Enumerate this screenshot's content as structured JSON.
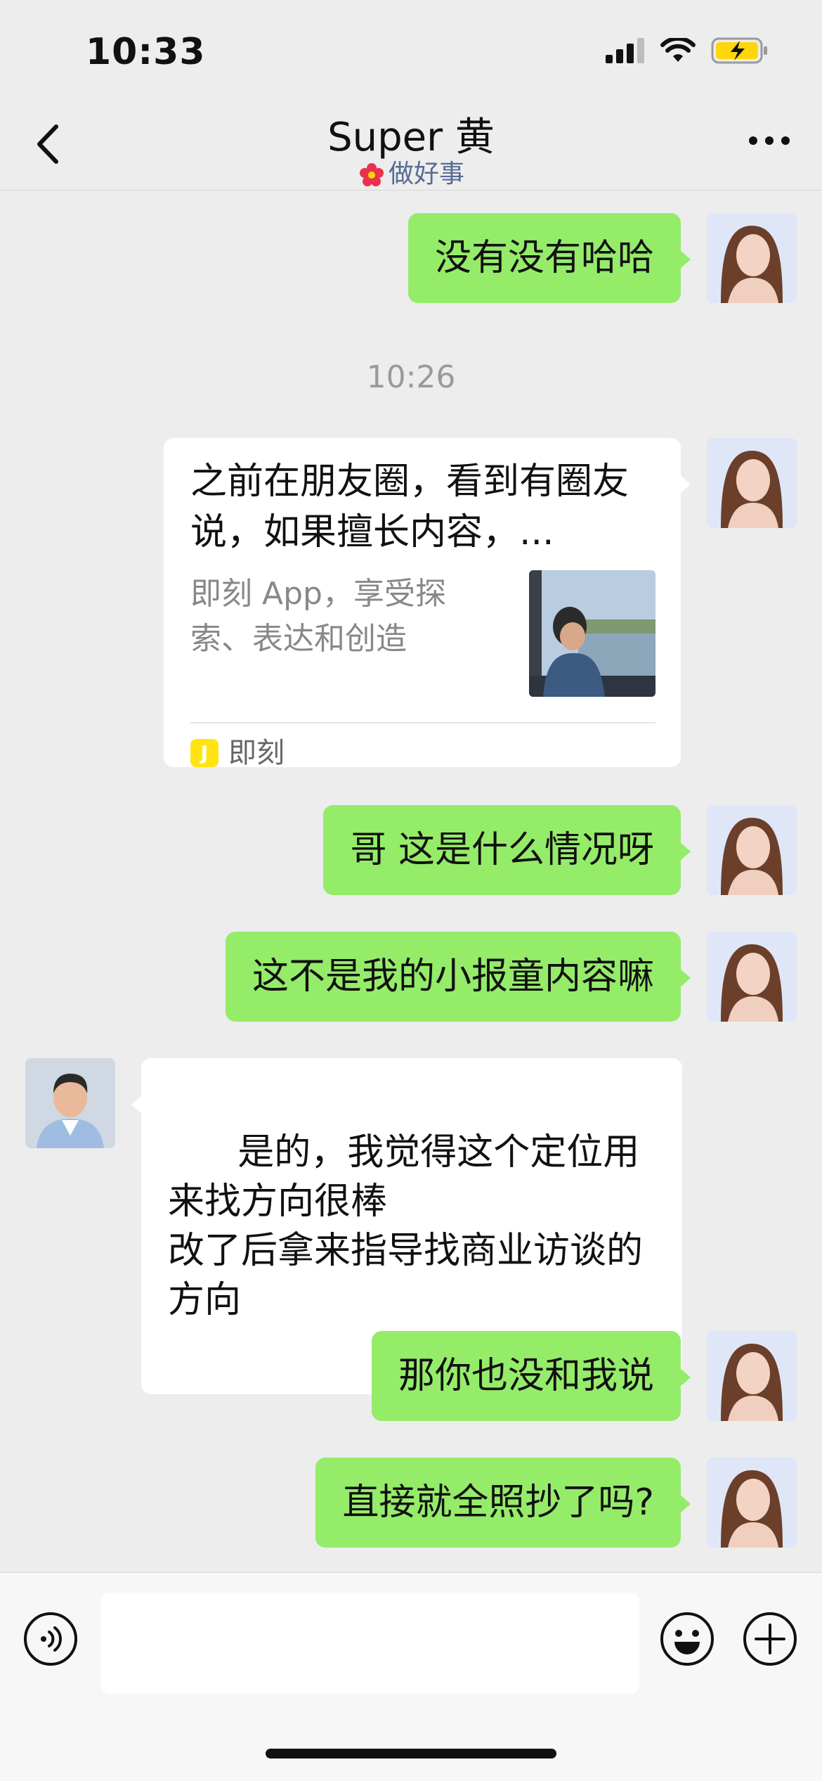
{
  "status_bar": {
    "time": "10:33"
  },
  "header": {
    "title": "Super 黄",
    "status_text": "做好事",
    "back_icon": "chevron-left-icon",
    "more_icon": "ellipsis-icon"
  },
  "messages": [
    {
      "side": "right",
      "type": "text",
      "text": "没有没有哈哈"
    },
    {
      "type": "timestamp",
      "text": "10:26"
    },
    {
      "side": "right",
      "type": "link_card",
      "title": "之前在朋友圈，看到有圈友说，如果擅长内容，...",
      "description": "即刻 App，享受探索、表达和创造",
      "source": "即刻"
    },
    {
      "side": "right",
      "type": "text",
      "text": "哥 这是什么情况呀"
    },
    {
      "side": "right",
      "type": "text",
      "text": "这不是我的小报童内容嘛"
    },
    {
      "side": "left",
      "type": "text",
      "text": "是的，我觉得这个定位用来找方向很棒\n改了后拿来指导找商业访谈的方向"
    },
    {
      "side": "right",
      "type": "text",
      "text": "那你也没和我说"
    },
    {
      "side": "right",
      "type": "text",
      "text": "直接就全照抄了吗?"
    }
  ],
  "input_bar": {
    "voice_icon": "voice-icon",
    "emoji_icon": "emoji-icon",
    "plus_icon": "plus-circle-icon",
    "input_value": ""
  },
  "colors": {
    "background": "#ededed",
    "outgoing_bubble": "#95ec69",
    "incoming_bubble": "#ffffff",
    "status_text": "#576b95",
    "battery_fill": "#ffd60a"
  }
}
